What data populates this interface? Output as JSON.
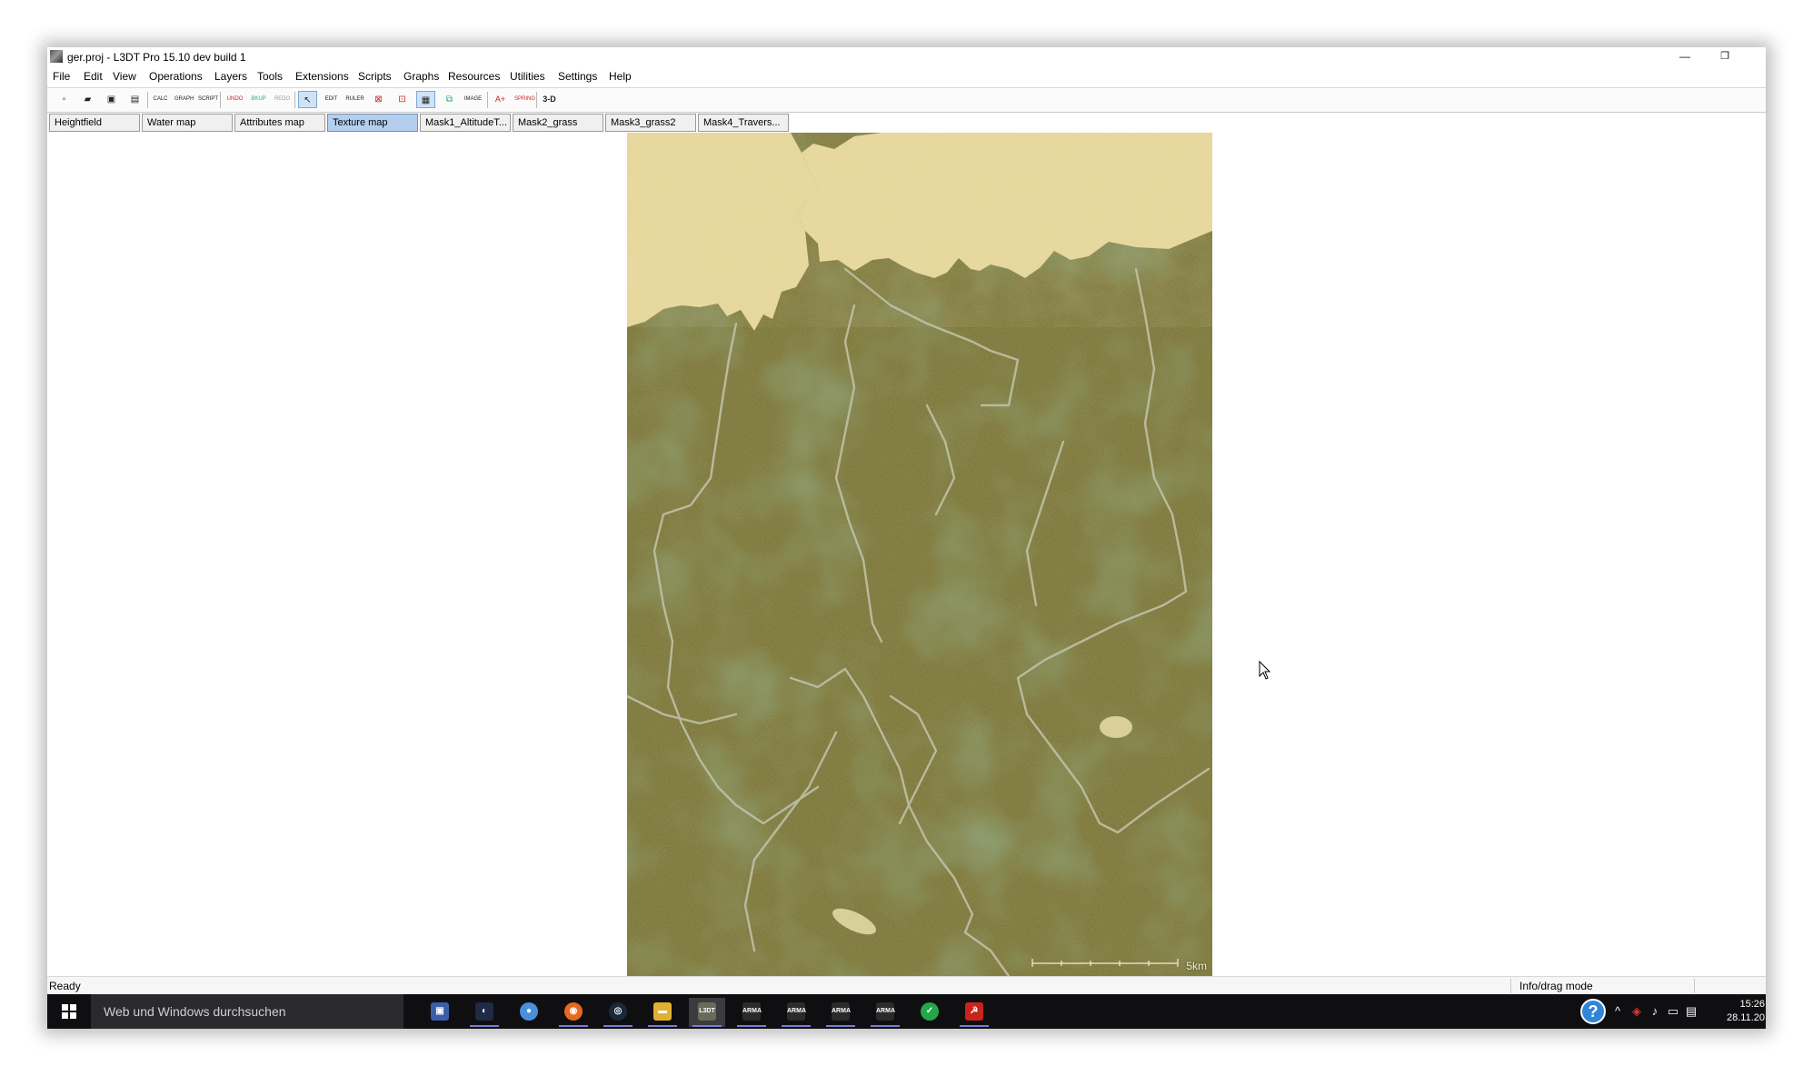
{
  "window": {
    "title": "ger.proj - L3DT Pro 15.10 dev build 1",
    "minimize": "—",
    "restore": "❐"
  },
  "menu": [
    "File",
    "Edit",
    "View",
    "Operations",
    "Layers",
    "Tools",
    "Extensions",
    "Scripts",
    "Graphs",
    "Resources",
    "Utilities",
    "Settings",
    "Help"
  ],
  "toolbar": {
    "buttons": [
      {
        "name": "new-icon",
        "glyph": "▫"
      },
      {
        "name": "open-icon",
        "glyph": "▰"
      },
      {
        "name": "save-all-icon",
        "glyph": "▣"
      },
      {
        "name": "save-icon",
        "glyph": "▤"
      },
      {
        "name": "calc-icon",
        "glyph": "CALC"
      },
      {
        "name": "graph-icon",
        "glyph": "GRAPH"
      },
      {
        "name": "script-icon",
        "glyph": "SCRIPT"
      },
      {
        "name": "undo-icon",
        "glyph": "UNDO"
      },
      {
        "name": "backup-icon",
        "glyph": "BKUP"
      },
      {
        "name": "redo-icon",
        "glyph": "REDO"
      },
      {
        "name": "pointer-icon",
        "glyph": "↖"
      },
      {
        "name": "edit-icon",
        "glyph": "EDIT"
      },
      {
        "name": "ruler-icon",
        "glyph": "RULER"
      },
      {
        "name": "zoom-fit-icon",
        "glyph": "⊠"
      },
      {
        "name": "zoom-area-icon",
        "glyph": "⊡"
      },
      {
        "name": "grid-icon",
        "glyph": "▦"
      },
      {
        "name": "drape-icon",
        "glyph": "⧉"
      },
      {
        "name": "image-drape-icon",
        "glyph": "IMAGE"
      },
      {
        "name": "add-point-icon",
        "glyph": "A+"
      },
      {
        "name": "spring-icon",
        "glyph": "SPRING"
      },
      {
        "name": "3d-view-icon",
        "glyph": "3-D"
      }
    ]
  },
  "tabs": [
    {
      "label": "Heightfield",
      "active": false
    },
    {
      "label": "Water map",
      "active": false
    },
    {
      "label": "Attributes map",
      "active": false
    },
    {
      "label": "Texture map",
      "active": true
    },
    {
      "label": "Mask1_AltitudeT...",
      "active": false
    },
    {
      "label": "Mask2_grass",
      "active": false
    },
    {
      "label": "Mask3_grass2",
      "active": false
    },
    {
      "label": "Mask4_Travers...",
      "active": false
    }
  ],
  "map": {
    "scale_label": "5km",
    "colors": {
      "terrain": "#6f6c2f",
      "sea": "#e4d59a",
      "rivers": "#b9bca2"
    }
  },
  "status": {
    "left": "Ready",
    "right": "Info/drag mode"
  },
  "taskbar": {
    "search_placeholder": "Web und Windows durchsuchen",
    "apps": [
      {
        "name": "network-app-icon",
        "glyph": "▣",
        "color": "#3a5fa8"
      },
      {
        "name": "steam-alt-icon",
        "glyph": "◐",
        "color": "#1f2a44"
      },
      {
        "name": "chrome-icon",
        "glyph": "●",
        "color": "#4a90d9"
      },
      {
        "name": "firefox-icon",
        "glyph": "◉",
        "color": "#e56a1e"
      },
      {
        "name": "steam-icon",
        "glyph": "◎",
        "color": "#1b2838"
      },
      {
        "name": "file-explorer-icon",
        "glyph": "▬",
        "color": "#e0b030"
      },
      {
        "name": "l3dt-icon",
        "glyph": "L3DT",
        "color": "#6a6a5a"
      },
      {
        "name": "arma-icon-1",
        "glyph": "ARMA",
        "color": "#2b2b2b"
      },
      {
        "name": "arma-icon-2",
        "glyph": "ARMA",
        "color": "#2b2b2b"
      },
      {
        "name": "arma-icon-3",
        "glyph": "ARMA",
        "color": "#2b2b2b"
      },
      {
        "name": "arma-icon-4",
        "glyph": "ARMA",
        "color": "#2b2b2b"
      },
      {
        "name": "green-app-icon",
        "glyph": "✓",
        "color": "#26a64a"
      },
      {
        "name": "red-app-icon",
        "glyph": "☭",
        "color": "#c8241e"
      }
    ],
    "tray": {
      "help": "?",
      "chevron": "^",
      "time": "15:26",
      "date": "28.11.20"
    }
  }
}
